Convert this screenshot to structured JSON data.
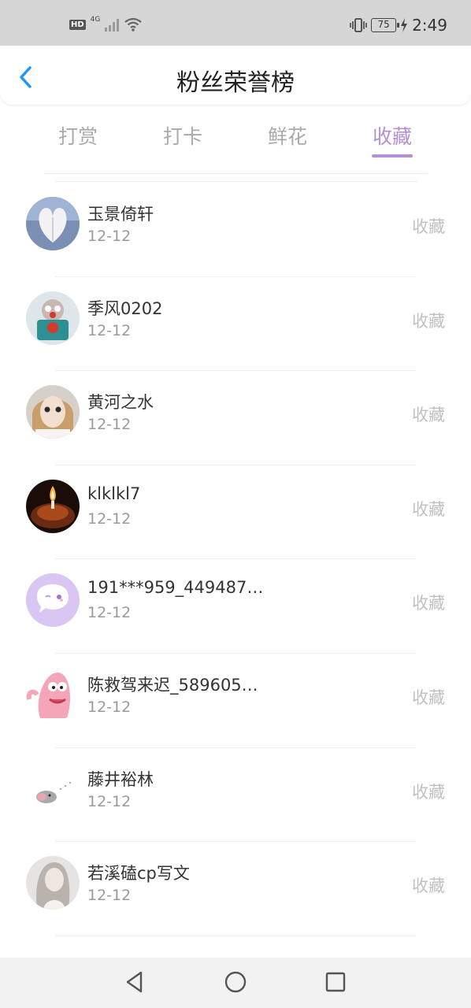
{
  "status_bar": {
    "hd": "HD",
    "network": "4G",
    "battery": "75",
    "time": "2:49"
  },
  "header": {
    "title": "粉丝荣誉榜"
  },
  "tabs": [
    {
      "label": "打赏"
    },
    {
      "label": "打卡"
    },
    {
      "label": "鲜花"
    },
    {
      "label": "收藏"
    }
  ],
  "active_tab": "收藏",
  "accent_color": "#b48fd8",
  "rows": [
    {
      "name": "玉景倚轩",
      "date": "12-12",
      "action": "收藏"
    },
    {
      "name": "季风0202",
      "date": "12-12",
      "action": "收藏"
    },
    {
      "name": "黄河之水",
      "date": "12-12",
      "action": "收藏"
    },
    {
      "name": "klklkl7",
      "date": "12-12",
      "action": "收藏"
    },
    {
      "name": "191***959_449487…",
      "date": "12-12",
      "action": "收藏"
    },
    {
      "name": "陈救驾来迟_589605…",
      "date": "12-12",
      "action": "收藏"
    },
    {
      "name": "藤井裕林",
      "date": "12-12",
      "action": "收藏"
    },
    {
      "name": "若溪磕cp写文",
      "date": "12-12",
      "action": "收藏"
    }
  ]
}
